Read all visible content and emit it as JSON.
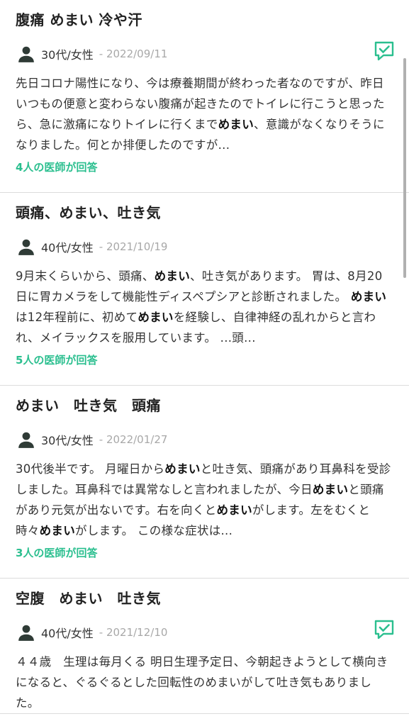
{
  "colors": {
    "accent": "#2bbf8f",
    "date": "#a8a8a8",
    "divider": "#dcdcdc"
  },
  "posts": [
    {
      "title": "腹痛 めまい 冷や汗",
      "author": "30代/女性",
      "date": "- 2022/09/11",
      "has_badge": true,
      "badge_icon": "checked-chat-icon",
      "body_segments": [
        {
          "t": "先日コロナ陽性になり、今は療養期間が終わった者なのですが、昨日いつもの便意と変わらない腹痛が起きたのでトイレに行こうと思ったら、急に激痛になりトイレに行くまで",
          "b": false
        },
        {
          "t": "めまい",
          "b": true
        },
        {
          "t": "、意識がなくなりそうになりました。何とか排便したのですが...",
          "b": false
        }
      ],
      "answers": "4人の医師が回答"
    },
    {
      "title": "頭痛、めまい、吐き気",
      "author": "40代/女性",
      "date": "- 2021/10/19",
      "has_badge": false,
      "body_segments": [
        {
          "t": "9月末くらいから、頭痛、",
          "b": false
        },
        {
          "t": "めまい",
          "b": true
        },
        {
          "t": "、吐き気があります。 胃は、8月20日に胃カメラをして機能性ディスペプシアと診断されました。 ",
          "b": false
        },
        {
          "t": "めまい",
          "b": true
        },
        {
          "t": "は12年程前に、初めて",
          "b": false
        },
        {
          "t": "めまい",
          "b": true
        },
        {
          "t": "を経験し、自律神経の乱れからと言われ、メイラックスを服用しています。 ...頭...",
          "b": false
        }
      ],
      "answers": "5人の医師が回答"
    },
    {
      "title": "めまい　吐き気　頭痛",
      "author": "30代/女性",
      "date": "- 2022/01/27",
      "has_badge": false,
      "body_segments": [
        {
          "t": "30代後半です。 月曜日から",
          "b": false
        },
        {
          "t": "めまい",
          "b": true
        },
        {
          "t": "と吐き気、頭痛があり耳鼻科を受診しました。耳鼻科では異常なしと言われましたが、今日",
          "b": false
        },
        {
          "t": "めまい",
          "b": true
        },
        {
          "t": "と頭痛があり元気が出ないです。右を向くと",
          "b": false
        },
        {
          "t": "めまい",
          "b": true
        },
        {
          "t": "がします。左をむくと時々",
          "b": false
        },
        {
          "t": "めまい",
          "b": true
        },
        {
          "t": "がします。 この様な症状は...",
          "b": false
        }
      ],
      "answers": "3人の医師が回答"
    },
    {
      "title": "空腹　めまい　吐き気",
      "author": "40代/女性",
      "date": "- 2021/12/10",
      "has_badge": true,
      "badge_icon": "checked-chat-icon",
      "body_segments": [
        {
          "t": "４４歳　生理は毎月くる 明日生理予定日、今朝起きようとして横向きになると、ぐるぐるとした回転性のめまいがして吐き気もありました。",
          "b": false
        }
      ],
      "answers": ""
    }
  ]
}
